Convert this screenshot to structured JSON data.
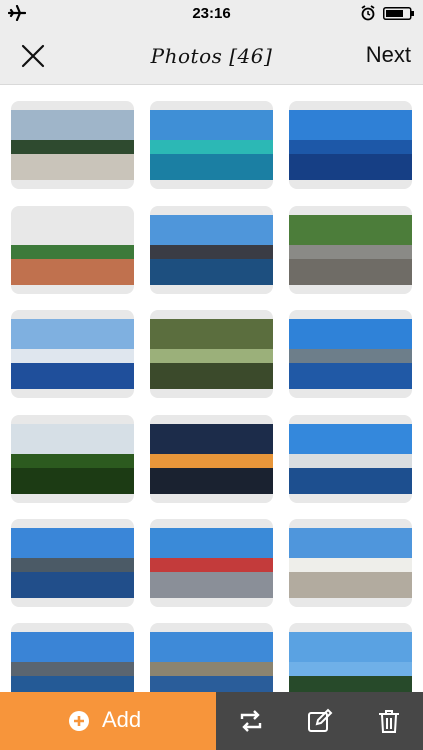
{
  "status_bar": {
    "time": "23:16",
    "icons": [
      "airplane-icon",
      "alarm-icon",
      "battery-icon"
    ]
  },
  "nav": {
    "close_icon": "close-icon",
    "title": "Photos [46]",
    "next_label": "Next"
  },
  "photos": [
    {
      "name": "building-fountain",
      "sky": "#9fb5c9",
      "mid": "#2e4a2f",
      "ground": "#c9c4ba"
    },
    {
      "name": "turquoise-sea",
      "sky": "#3f8fd6",
      "mid": "#2cb8b5",
      "ground": "#1b7fa3"
    },
    {
      "name": "open-ocean",
      "sky": "#2f80d6",
      "mid": "#1d58a8",
      "ground": "#163f85"
    },
    {
      "name": "garden-planter",
      "sky": "#e8e8e8",
      "mid": "#3d7a3a",
      "ground": "#c0714e"
    },
    {
      "name": "harbour-bridge",
      "sky": "#4f96da",
      "mid": "#3a3c44",
      "ground": "#1d4f7f"
    },
    {
      "name": "stone-stairs",
      "sky": "#4c7d3a",
      "mid": "#8a8a86",
      "ground": "#6f6c66"
    },
    {
      "name": "plane-wing",
      "sky": "#7fb0e0",
      "mid": "#dfe6ee",
      "ground": "#1f4f9b"
    },
    {
      "name": "palm-trees",
      "sky": "#5b6e3e",
      "mid": "#9bb07a",
      "ground": "#3b4a2b"
    },
    {
      "name": "city-waterfront",
      "sky": "#2f82d8",
      "mid": "#6d7e8a",
      "ground": "#2059a6"
    },
    {
      "name": "tree-canopy",
      "sky": "#d6dfe6",
      "mid": "#2c5a1f",
      "ground": "#1c3b14"
    },
    {
      "name": "sunset-skyline",
      "sky": "#1c2c4a",
      "mid": "#e8963a",
      "ground": "#1a2230"
    },
    {
      "name": "opera-house-bridge",
      "sky": "#3488dc",
      "mid": "#d9dde0",
      "ground": "#1d4f8f"
    },
    {
      "name": "harbour-bridge-far",
      "sky": "#3a86d8",
      "mid": "#4b5a66",
      "ground": "#214e8a"
    },
    {
      "name": "ferry-wharf",
      "sky": "#3a8ad8",
      "mid": "#c33b3b",
      "ground": "#8a8f98"
    },
    {
      "name": "opera-house-close",
      "sky": "#4f96dc",
      "mid": "#eeeeea",
      "ground": "#b2ab9f"
    },
    {
      "name": "bridge-skyline",
      "sky": "#3a84d6",
      "mid": "#5a6570",
      "ground": "#245a96"
    },
    {
      "name": "waterfront-buildings",
      "sky": "#3e8ad8",
      "mid": "#8b8470",
      "ground": "#2a5d9a"
    },
    {
      "name": "skywriting",
      "sky": "#5aa2e2",
      "mid": "#6fb0e8",
      "ground": "#274a2a"
    }
  ],
  "toolbar": {
    "add_label": "Add",
    "icons": [
      "plus-circle-icon",
      "rotate-icon",
      "edit-icon",
      "trash-icon"
    ]
  },
  "colors": {
    "accent": "#f7953b",
    "toolbar_bg": "#474747",
    "bar_bg": "#ededed"
  }
}
